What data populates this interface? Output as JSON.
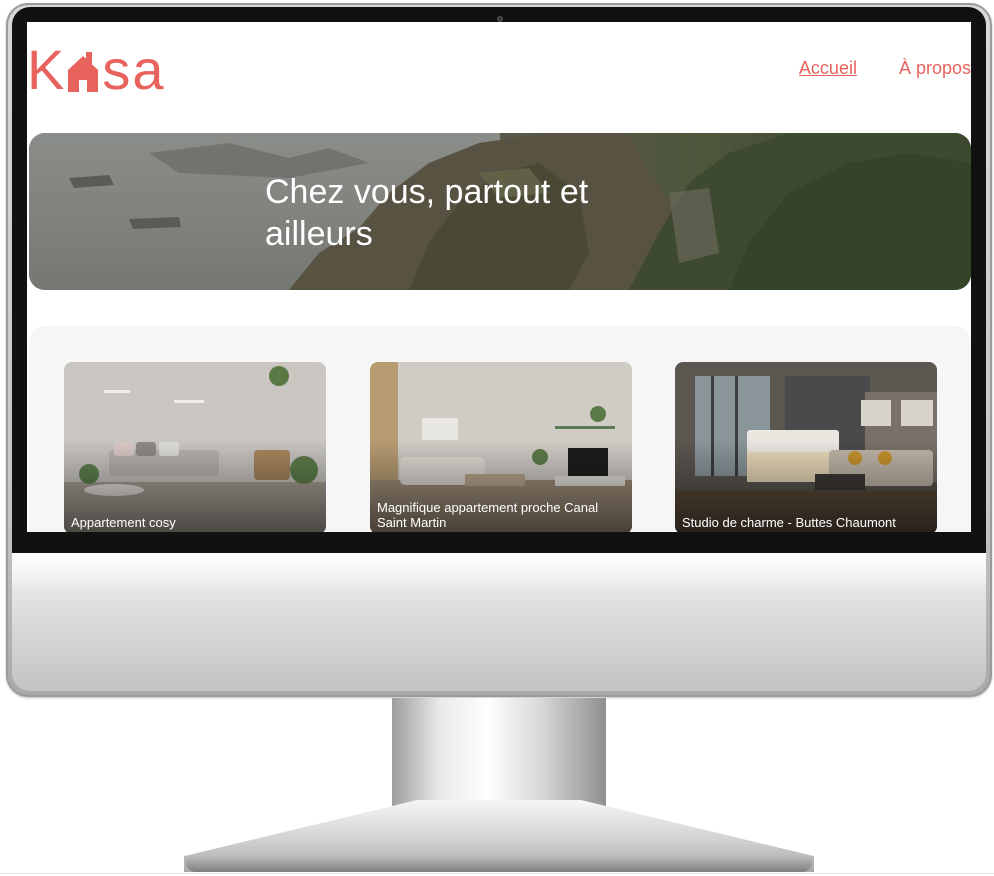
{
  "site": {
    "logo_text_start": "K",
    "logo_text_end": "sa",
    "brand_color": "#e8635e"
  },
  "nav": {
    "items": [
      {
        "label": "Accueil",
        "active": true
      },
      {
        "label": "À propos",
        "active": false
      }
    ]
  },
  "banner": {
    "title": "Chez vous, partout et ailleurs"
  },
  "gallery": {
    "cards": [
      {
        "title": "Appartement cosy",
        "image": "living-room-photo"
      },
      {
        "title": "Magnifique appartement proche Canal Saint Martin",
        "image": "living-room-photo"
      },
      {
        "title": "Studio de charme - Buttes Chaumont",
        "image": "hotel-room-photo"
      }
    ]
  },
  "device": {
    "type": "desktop-monitor",
    "frame_color": "#c6c6c6",
    "bezel_color": "#111111"
  }
}
